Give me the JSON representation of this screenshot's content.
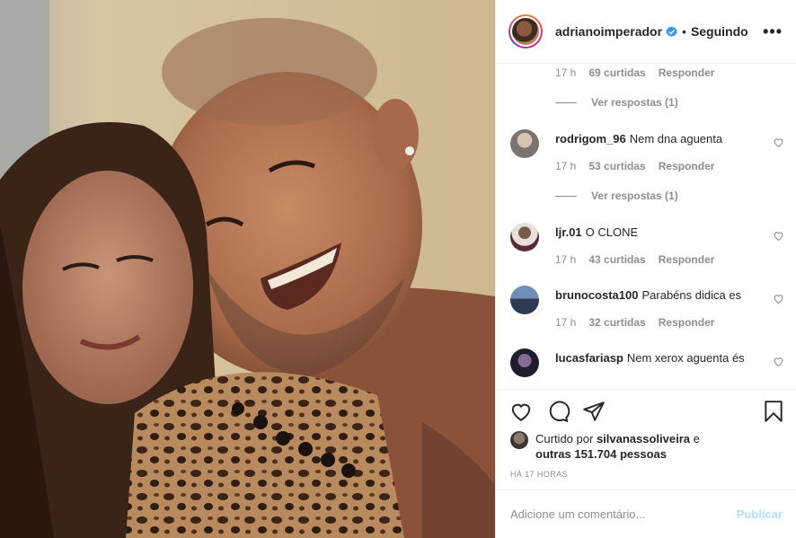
{
  "post": {
    "image_alt": "",
    "header": {
      "username": "adrianoimperador",
      "separator": "•",
      "follow_status": "Seguindo",
      "more_label": "•••",
      "verified_icon": "verified-badge-icon",
      "accent_color": "#3897f0"
    },
    "comments": [
      {
        "username": "",
        "text": "",
        "time": "17 h",
        "likes": "69 curtidas",
        "reply_label": "Responder",
        "view_replies": "Ver respostas (1)"
      },
      {
        "username": "rodrigom_96",
        "text": "Nem dna aguenta",
        "time": "17 h",
        "likes": "53 curtidas",
        "reply_label": "Responder",
        "view_replies": "Ver respostas (1)"
      },
      {
        "username": "ljr.01",
        "text": "O CLONE",
        "time": "17 h",
        "likes": "43 curtidas",
        "reply_label": "Responder"
      },
      {
        "username": "brunocosta100",
        "text": "Parabéns didica es",
        "time": "17 h",
        "likes": "32 curtidas",
        "reply_label": "Responder"
      },
      {
        "username": "lucasfariasp",
        "text": "Nem xerox aguenta és"
      }
    ],
    "likes": {
      "prefix": "Curtido por",
      "user": "silvanassoliveira",
      "and": "e",
      "others": "outras 151.704 pessoas"
    },
    "time_ago": "HÁ 17 HORAS",
    "add_comment": {
      "placeholder": "Adicione um comentário...",
      "publish_label": "Publicar",
      "publish_color": "#b2dffc"
    }
  }
}
